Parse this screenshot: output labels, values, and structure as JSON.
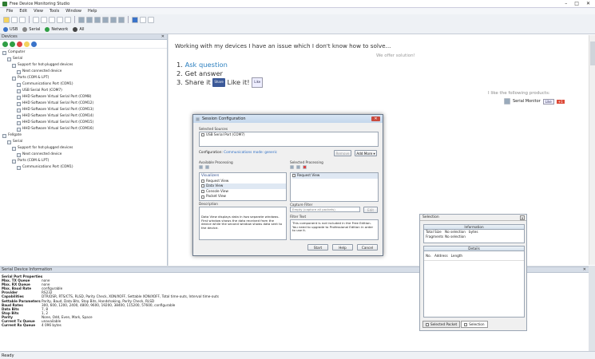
{
  "window": {
    "title": "Free Device Monitoring Studio"
  },
  "menu": [
    "File",
    "Edit",
    "View",
    "Tools",
    "Window",
    "Help"
  ],
  "filters": [
    {
      "label": "USB",
      "color": "#3a73c9"
    },
    {
      "label": "Serial",
      "color": "#888"
    },
    {
      "label": "Network",
      "color": "#2f9e44"
    },
    {
      "label": "All",
      "color": "#444"
    }
  ],
  "devices": {
    "title": "Devices",
    "tree": [
      {
        "level": 0,
        "label": "Computer"
      },
      {
        "level": 1,
        "label": "Serial"
      },
      {
        "level": 2,
        "label": "Support for hot-plugged devices"
      },
      {
        "level": 3,
        "label": "Next connected device"
      },
      {
        "level": 2,
        "label": "Ports (COM & LPT)"
      },
      {
        "level": 3,
        "label": "Communications Port (COM1)"
      },
      {
        "level": 3,
        "label": "USB Serial Port (COM7)"
      },
      {
        "level": 3,
        "label": "HHD Software Virtual Serial Port (COM8)"
      },
      {
        "level": 3,
        "label": "HHD Software Virtual Serial Port (COM12)"
      },
      {
        "level": 3,
        "label": "HHD Software Virtual Serial Port (COM13)"
      },
      {
        "level": 3,
        "label": "HHD Software Virtual Serial Port (COM14)"
      },
      {
        "level": 3,
        "label": "HHD Software Virtual Serial Port (COM15)"
      },
      {
        "level": 3,
        "label": "HHD Software Virtual Serial Port (COM16)"
      },
      {
        "level": 0,
        "label": "Fellgate"
      },
      {
        "level": 1,
        "label": "Serial"
      },
      {
        "level": 2,
        "label": "Support for hot-plugged devices"
      },
      {
        "level": 3,
        "label": "Next connected device"
      },
      {
        "level": 2,
        "label": "Ports (COM & LPT)"
      },
      {
        "level": 3,
        "label": "Communications Port (COM1)"
      }
    ]
  },
  "content": {
    "heading": "Working with my devices I have an issue which I don't know how to solve...",
    "offer": "We offer solution!",
    "step1": "Ask question",
    "step2": "Get answer",
    "step3": "Share it",
    "like_text": "Like it!",
    "fb_share": "Share",
    "like_btn": "Like",
    "ilike": "I like the following products:",
    "product": "Serial Monitor",
    "plus": "+1"
  },
  "session": {
    "title": "Session Configuration",
    "selected_sources_label": "Selected Sources",
    "source": "USB Serial Port (COM7)",
    "configuration_label": "Configuration:",
    "configuration_value": "Communications mode: generic",
    "remove": "Remove",
    "add_more": "Add More",
    "available_label": "Available Processing",
    "selected_label": "Selected Processing",
    "visualizers_header": "Visualizers",
    "available_items": [
      "Request View",
      "Data View",
      "Console View",
      "Packet View"
    ],
    "selected_items": [
      "Request View"
    ],
    "description_label": "Description",
    "description": "Data View displays data in two separate windows. First window shows the data received from the device while the second window shows data sent to the device.",
    "capture_filter_label": "Capture Filter",
    "capture_filter_value": "Empty (capture all packets)",
    "edit": "Edit",
    "filter_text_label": "Filter Text",
    "filter_text": "This component is not included in the Free Edition. You need to upgrade to Professional Edition in order to use it.",
    "start": "Start",
    "help": "Help",
    "cancel": "Cancel"
  },
  "selection": {
    "title": "Selection",
    "info_header": "Information",
    "total_size_label": "Total Size",
    "total_size_value": "No selection",
    "total_size_unit": "bytes",
    "fragments_label": "Fragments",
    "fragments_value": "No selection",
    "details_header": "Details",
    "cols": [
      "No.",
      "Address",
      "Length"
    ],
    "tab1": "Selected Packet",
    "tab2": "Selection"
  },
  "sdi": {
    "title": "Serial Device Information",
    "header": "Serial Port Properties",
    "rows": [
      {
        "k": "Max. TX Queue",
        "v": "none"
      },
      {
        "k": "Max. RX Queue",
        "v": "none"
      },
      {
        "k": "Max. Baud Rate",
        "v": "configurable"
      },
      {
        "k": "Provider",
        "v": "RS232"
      },
      {
        "k": "Capabilities",
        "v": "DTR/DSR, RTS/CTS, RLSD, Parity Check, XON/XOFF, Settable XON/XOFF, Total time-outs, Interval time-outs"
      },
      {
        "k": "Settable Parameters",
        "v": "Parity, Baud, Data Bits, Stop Bits, Handshaking, Parity Check, RLSD"
      },
      {
        "k": "Baud Rates",
        "v": "300, 600, 1200, 2400, 4800, 9600, 19200, 38400, 115200, 57600, configurable"
      },
      {
        "k": "Data Bits",
        "v": "7, 8"
      },
      {
        "k": "Stop Bits",
        "v": "1, 2"
      },
      {
        "k": "Parity",
        "v": "None, Odd, Even, Mark, Space"
      },
      {
        "k": "Current Tx Queue",
        "v": "unavailable"
      },
      {
        "k": "Current Rx Queue",
        "v": "4 096 bytes"
      }
    ]
  },
  "status": "Ready"
}
